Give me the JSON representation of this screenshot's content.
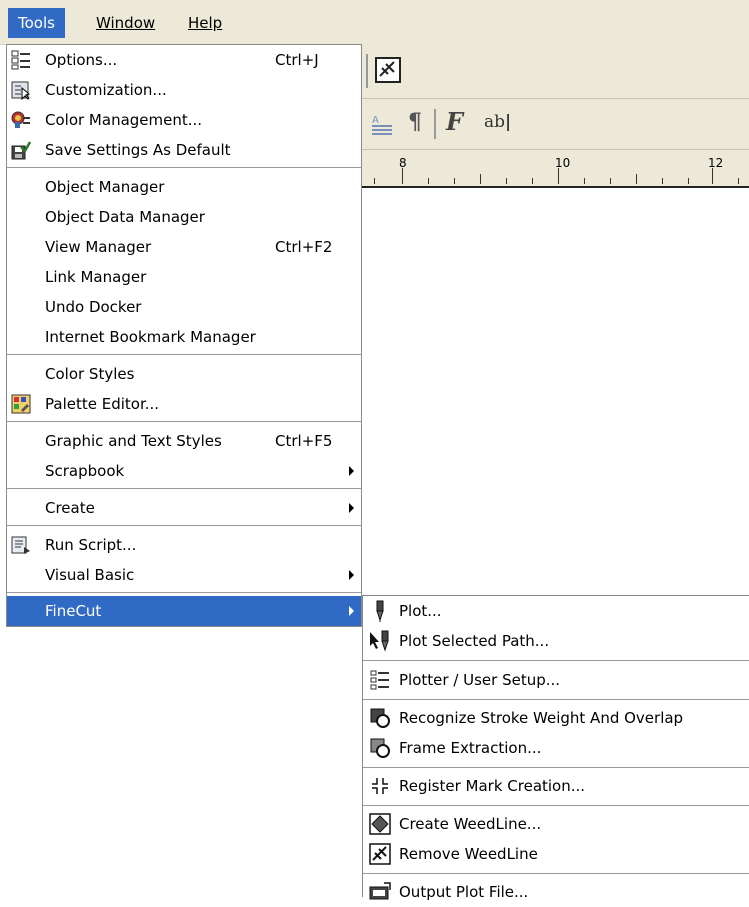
{
  "menubar": {
    "items": [
      {
        "label": "Tools",
        "active": true
      },
      {
        "label": "Window",
        "active": false
      },
      {
        "label": "Help",
        "active": false
      }
    ]
  },
  "toolbar": {
    "text_label": "ab"
  },
  "ruler": {
    "labels": [
      "8",
      "10",
      "12"
    ]
  },
  "tools_menu": {
    "items": [
      {
        "label": "Options...",
        "shortcut": "Ctrl+J",
        "icon": "options-icon"
      },
      {
        "label": "Customization...",
        "shortcut": "",
        "icon": "customization-icon"
      },
      {
        "label": "Color Management...",
        "shortcut": "",
        "icon": "color-management-icon"
      },
      {
        "label": "Save Settings As Default",
        "shortcut": "",
        "icon": "save-settings-icon"
      },
      {
        "label": "Object Manager",
        "shortcut": ""
      },
      {
        "label": "Object Data Manager",
        "shortcut": ""
      },
      {
        "label": "View Manager",
        "shortcut": "Ctrl+F2"
      },
      {
        "label": "Link Manager",
        "shortcut": ""
      },
      {
        "label": "Undo Docker",
        "shortcut": ""
      },
      {
        "label": "Internet Bookmark Manager",
        "shortcut": ""
      },
      {
        "label": "Color Styles",
        "shortcut": ""
      },
      {
        "label": "Palette Editor...",
        "shortcut": "",
        "icon": "palette-editor-icon"
      },
      {
        "label": "Graphic and Text Styles",
        "shortcut": "Ctrl+F5"
      },
      {
        "label": "Scrapbook",
        "shortcut": "",
        "submenu": true
      },
      {
        "label": "Create",
        "shortcut": "",
        "submenu": true
      },
      {
        "label": "Run Script...",
        "shortcut": "",
        "icon": "run-script-icon"
      },
      {
        "label": "Visual Basic",
        "shortcut": "",
        "submenu": true
      },
      {
        "label": "FineCut",
        "shortcut": "",
        "submenu": true,
        "highlighted": true
      }
    ]
  },
  "finecut_submenu": {
    "items": [
      {
        "label": "Plot...",
        "icon": "plot-icon"
      },
      {
        "label": "Plot Selected Path...",
        "icon": "plot-selected-path-icon"
      },
      {
        "label": "Plotter / User Setup...",
        "icon": "plotter-setup-icon"
      },
      {
        "label": "Recognize Stroke Weight And Overlap",
        "icon": "recognize-stroke-icon"
      },
      {
        "label": "Frame Extraction...",
        "icon": "frame-extraction-icon"
      },
      {
        "label": "Register Mark Creation...",
        "icon": "register-mark-icon"
      },
      {
        "label": "Create WeedLine...",
        "icon": "create-weedline-icon"
      },
      {
        "label": "Remove WeedLine",
        "icon": "remove-weedline-icon"
      },
      {
        "label": "Output Plot File...",
        "icon": "output-plot-file-icon"
      }
    ]
  }
}
